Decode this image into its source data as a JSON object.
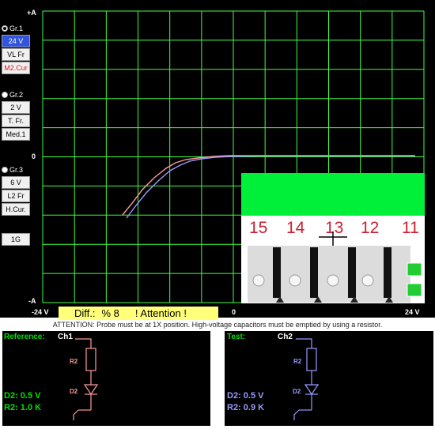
{
  "colors": {
    "scope_bg": "#000000",
    "grid": "#40ff40",
    "trace_ref": "#ff9a9a",
    "trace_test": "#9a9aff",
    "diff_bar": "#ffff7a",
    "photo_green": "#00f03a",
    "pin_numbers": "#cc1e2e",
    "ref_accent": "#00e000",
    "ref_circuit": "#ff9a9a",
    "test_circuit": "#9a9aff",
    "test_accent": "#00e000"
  },
  "axes": {
    "top": "+A",
    "zero_left": "0",
    "bottom": "-A",
    "x_left": "-24 V",
    "x_center": "0",
    "x_right": "24 V"
  },
  "groups": [
    {
      "radio_label": "Gr.1",
      "selected": true,
      "buttons": [
        "24 V",
        "VL Fr",
        "M2.Cur"
      ],
      "icon": "radio-icon"
    },
    {
      "radio_label": "Gr.2",
      "selected": false,
      "buttons": [
        "2 V",
        "T. Fr.",
        "Med.1"
      ],
      "icon": "radio-icon"
    },
    {
      "radio_label": "Gr.3",
      "selected": false,
      "buttons": [
        "6 V",
        "L2 Fr",
        "H.Cur."
      ],
      "icon": "radio-icon"
    }
  ],
  "channel_button": "1G",
  "status": {
    "diff_label": "Diff.:",
    "diff_value": "% 8",
    "attention": "! Attention !"
  },
  "attention_text": "ATTENTION: Probe must be at 1X position. High-voltage capacitors must be emptied by using a resistor.",
  "photo": {
    "pins": [
      "15",
      "14",
      "13",
      "12",
      "11"
    ],
    "selected_pin": "13"
  },
  "reference": {
    "title": "Reference:",
    "channel": "Ch1",
    "r_label": "R2",
    "d_label": "D2",
    "d_value": "D2: 0.5 V",
    "r_value": "R2: 1.0 K"
  },
  "test": {
    "title": "Test:",
    "channel": "Ch2",
    "r_label": "R2",
    "d_label": "D2",
    "d_value": "D2: 0.5 V",
    "r_value": "R2: 0.9 K"
  }
}
